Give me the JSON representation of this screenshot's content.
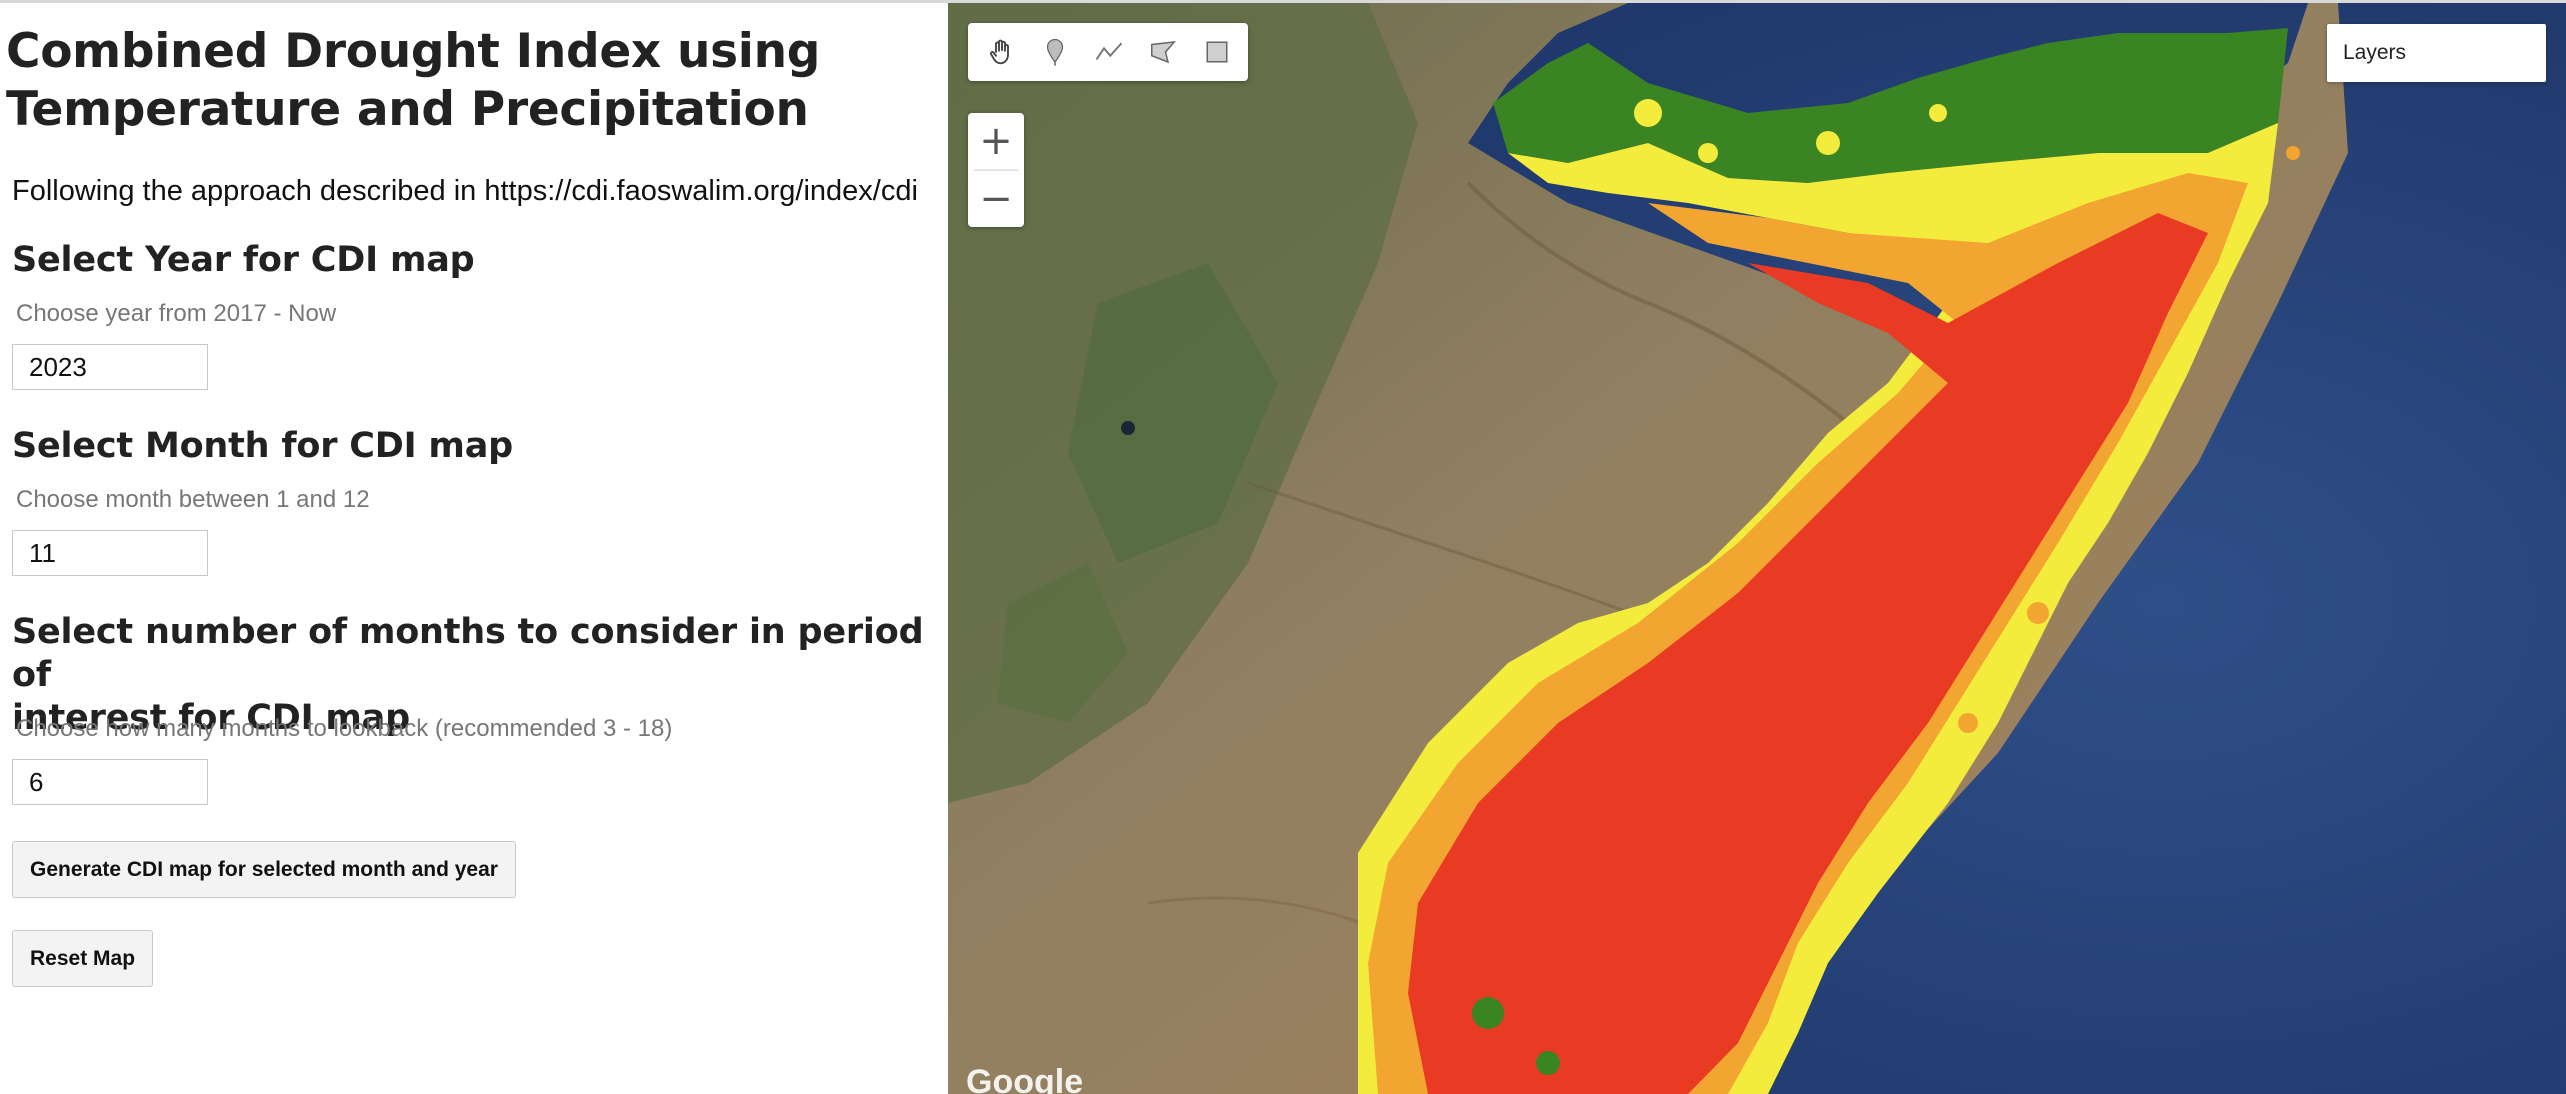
{
  "panel": {
    "title_line1": "Combined Drought Index using",
    "title_line2": "Temperature and Precipitation",
    "description": "Following the approach described in https://cdi.faoswalim.org/index/cdi",
    "year": {
      "heading": "Select Year for CDI map",
      "hint": "Choose year from 2017 - Now",
      "value": "2023"
    },
    "month": {
      "heading": "Select Month for CDI map",
      "hint": "Choose month between 1 and 12",
      "value": "11"
    },
    "period": {
      "heading_line1": "Select number of months to consider in period of",
      "heading_line2": "interest for CDI map",
      "hint": "Choose how many months to lookback (recommended 3 - 18)",
      "value": "6"
    },
    "generate_button": "Generate CDI map for selected month and year",
    "reset_button": "Reset Map"
  },
  "map": {
    "layers_label": "Layers",
    "zoom_in_label": "+",
    "zoom_out_label": "−",
    "attribution": "Google",
    "drawing_tools": [
      "hand-icon",
      "marker-icon",
      "line-icon",
      "polygon-icon",
      "rectangle-icon"
    ],
    "legend_colors": {
      "green": "#3a8424",
      "yellow": "#f4ec3c",
      "orange": "#f3a531",
      "red": "#e93a24"
    }
  }
}
